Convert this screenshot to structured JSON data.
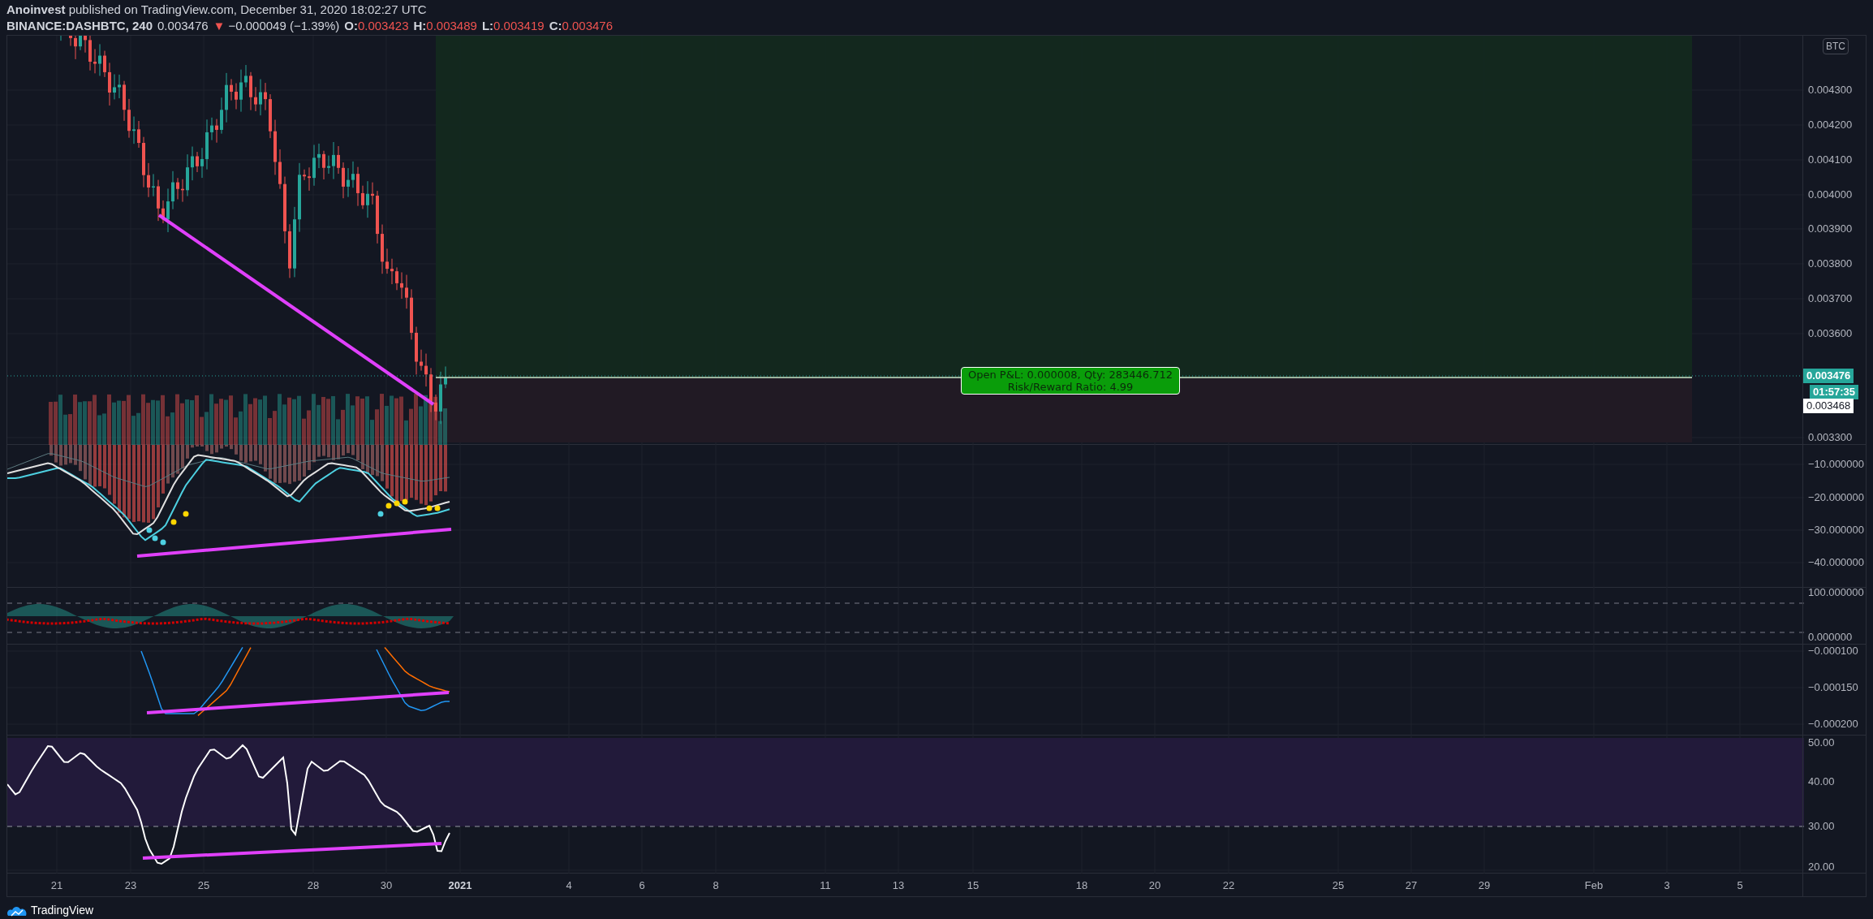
{
  "header": {
    "published": "**Anoinvest** published on TradingView.com, December 31, 2020 18:02:27 UTC",
    "symbol": "BINANCE:DASHBTC, 240",
    "last": "0.003476",
    "direction": "▼",
    "change": "−0.000049 (−1.39%)",
    "ohlc": [
      {
        "label": "O:",
        "value": "0.003423"
      },
      {
        "label": "H:",
        "value": "0.003489"
      },
      {
        "label": "L:",
        "value": "0.003419"
      },
      {
        "label": "C:",
        "value": "0.003476"
      }
    ]
  },
  "price_pane": {
    "currency": "BTC",
    "axis_labels": [
      "0.004300",
      "0.004200",
      "0.004100",
      "0.004000",
      "0.003900",
      "0.003800",
      "0.003700",
      "0.003600",
      "0.003300"
    ],
    "price_tags": [
      {
        "kind": "last",
        "text": "0.003476"
      },
      {
        "kind": "countdown",
        "text": "01:57:35"
      },
      {
        "kind": "entry",
        "text": "0.003468"
      }
    ],
    "position_label": [
      "Open P&L: 0.000008, Qty: 283446.712",
      "Risk/Reward Ratio: 4.99"
    ]
  },
  "indicator_panes": [
    {
      "axis_labels": [
        "−10.000000",
        "−20.000000",
        "−30.000000",
        "−40.000000"
      ]
    },
    {
      "axis_labels": [
        "100.000000",
        "0.000000"
      ]
    },
    {
      "axis_labels": [
        "−0.000100",
        "−0.000150",
        "−0.000200"
      ]
    },
    {
      "axis_labels": [
        "50.00",
        "40.00",
        "30.00",
        "20.00"
      ]
    }
  ],
  "time_axis": [
    {
      "kind": "day",
      "text": "21"
    },
    {
      "kind": "day",
      "text": "23"
    },
    {
      "kind": "day",
      "text": "25"
    },
    {
      "kind": "day",
      "text": "28"
    },
    {
      "kind": "day",
      "text": "30"
    },
    {
      "kind": "year",
      "text": "2021"
    },
    {
      "kind": "day",
      "text": "4"
    },
    {
      "kind": "day",
      "text": "6"
    },
    {
      "kind": "day",
      "text": "8"
    },
    {
      "kind": "day",
      "text": "11"
    },
    {
      "kind": "day",
      "text": "13"
    },
    {
      "kind": "day",
      "text": "15"
    },
    {
      "kind": "day",
      "text": "18"
    },
    {
      "kind": "day",
      "text": "20"
    },
    {
      "kind": "day",
      "text": "22"
    },
    {
      "kind": "day",
      "text": "25"
    },
    {
      "kind": "day",
      "text": "27"
    },
    {
      "kind": "day",
      "text": "29"
    },
    {
      "kind": "month",
      "text": "Feb"
    },
    {
      "kind": "day",
      "text": "3"
    },
    {
      "kind": "day",
      "text": "5"
    }
  ],
  "footer": {
    "brand": "TradingView"
  }
}
